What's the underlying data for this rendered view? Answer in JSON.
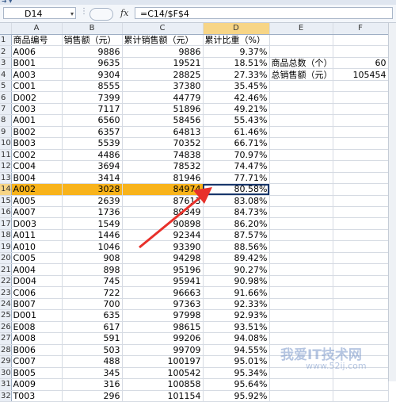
{
  "window": {
    "quick_access": "➜  ▾"
  },
  "formula_bar": {
    "name_box": "D14",
    "name_box_dropdown": "▾",
    "fx_label": "fx",
    "formula": "=C14/$F$4"
  },
  "columns": [
    "A",
    "B",
    "C",
    "D",
    "E",
    "F"
  ],
  "header_row": {
    "num": "1",
    "a": "商品编号",
    "b": "销售额（元）",
    "c": "累计销售额（元）",
    "d": "累计比重（%）"
  },
  "rows": [
    {
      "num": "2",
      "a": "A006",
      "b": "9886",
      "c": "9886",
      "d": "9.37%"
    },
    {
      "num": "3",
      "a": "B001",
      "b": "9635",
      "c": "19521",
      "d": "18.51%",
      "e": "商品总数（个）",
      "f": "60"
    },
    {
      "num": "4",
      "a": "A003",
      "b": "9304",
      "c": "28825",
      "d": "27.33%",
      "e": "总销售额（元）",
      "f": "105454"
    },
    {
      "num": "5",
      "a": "C001",
      "b": "8555",
      "c": "37380",
      "d": "35.45%"
    },
    {
      "num": "6",
      "a": "D002",
      "b": "7399",
      "c": "44779",
      "d": "42.46%"
    },
    {
      "num": "7",
      "a": "C003",
      "b": "7117",
      "c": "51896",
      "d": "49.21%"
    },
    {
      "num": "8",
      "a": "A001",
      "b": "6560",
      "c": "58456",
      "d": "55.43%"
    },
    {
      "num": "9",
      "a": "B002",
      "b": "6357",
      "c": "64813",
      "d": "61.46%"
    },
    {
      "num": "10",
      "a": "B003",
      "b": "5539",
      "c": "70352",
      "d": "66.71%"
    },
    {
      "num": "11",
      "a": "C002",
      "b": "4486",
      "c": "74838",
      "d": "70.97%"
    },
    {
      "num": "12",
      "a": "C004",
      "b": "3694",
      "c": "78532",
      "d": "74.47%"
    },
    {
      "num": "13",
      "a": "B004",
      "b": "3414",
      "c": "81946",
      "d": "77.71%"
    },
    {
      "num": "14",
      "a": "A002",
      "b": "3028",
      "c": "84974",
      "d": "80.58%"
    },
    {
      "num": "15",
      "a": "A005",
      "b": "2639",
      "c": "87613",
      "d": "83.08%"
    },
    {
      "num": "16",
      "a": "A007",
      "b": "1736",
      "c": "89349",
      "d": "84.73%"
    },
    {
      "num": "17",
      "a": "D003",
      "b": "1549",
      "c": "90898",
      "d": "86.20%"
    },
    {
      "num": "18",
      "a": "A011",
      "b": "1446",
      "c": "92344",
      "d": "87.57%"
    },
    {
      "num": "19",
      "a": "A010",
      "b": "1046",
      "c": "93390",
      "d": "88.56%"
    },
    {
      "num": "20",
      "a": "C005",
      "b": "908",
      "c": "94298",
      "d": "89.42%"
    },
    {
      "num": "21",
      "a": "A004",
      "b": "898",
      "c": "95196",
      "d": "90.27%"
    },
    {
      "num": "22",
      "a": "D004",
      "b": "745",
      "c": "95941",
      "d": "90.98%"
    },
    {
      "num": "23",
      "a": "C006",
      "b": "722",
      "c": "96663",
      "d": "91.66%"
    },
    {
      "num": "24",
      "a": "B007",
      "b": "700",
      "c": "97363",
      "d": "92.33%"
    },
    {
      "num": "25",
      "a": "D001",
      "b": "635",
      "c": "97998",
      "d": "92.93%"
    },
    {
      "num": "26",
      "a": "E008",
      "b": "617",
      "c": "98615",
      "d": "93.51%"
    },
    {
      "num": "27",
      "a": "A008",
      "b": "591",
      "c": "99206",
      "d": "94.08%"
    },
    {
      "num": "28",
      "a": "B006",
      "b": "503",
      "c": "99709",
      "d": "94.55%"
    },
    {
      "num": "29",
      "a": "C007",
      "b": "488",
      "c": "100197",
      "d": "95.01%"
    },
    {
      "num": "30",
      "a": "B005",
      "b": "345",
      "c": "100542",
      "d": "95.34%"
    },
    {
      "num": "31",
      "a": "A009",
      "b": "316",
      "c": "100858",
      "d": "95.64%"
    },
    {
      "num": "32",
      "a": "T003",
      "b": "296",
      "c": "101154",
      "d": "95.92%"
    }
  ],
  "watermark": {
    "line1": "我爱IT技术网",
    "line2": "www.52ij.com"
  },
  "colors": {
    "highlight": "#f8b31b",
    "active_border": "#17366b",
    "arrow": "#e8302a"
  }
}
